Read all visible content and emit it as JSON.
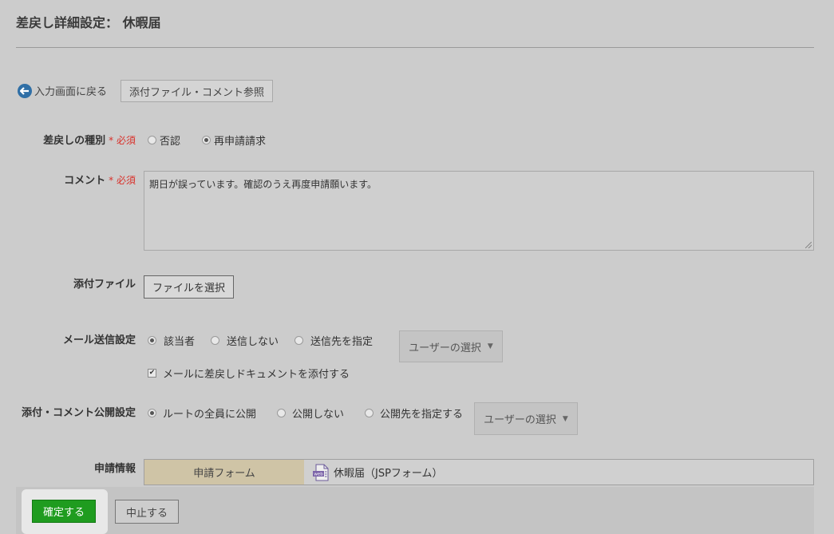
{
  "header": {
    "title": "差戻し詳細設定： 休暇届"
  },
  "toolbar": {
    "back_label": "入力画面に戻る",
    "attachments_button": "添付ファイル・コメント参照"
  },
  "form": {
    "required_marker": "* 必須",
    "reject_type": {
      "label": "差戻しの種別",
      "options": [
        {
          "label": "否認",
          "selected": false
        },
        {
          "label": "再申請請求",
          "selected": true
        }
      ]
    },
    "comment": {
      "label": "コメント",
      "value": "期日が誤っています。確認のうえ再度申請願います。"
    },
    "attachment": {
      "label": "添付ファイル",
      "button": "ファイルを選択"
    },
    "mail": {
      "label": "メール送信設定",
      "options": [
        {
          "label": "該当者",
          "selected": true
        },
        {
          "label": "送信しない",
          "selected": false
        },
        {
          "label": "送信先を指定",
          "selected": false
        }
      ],
      "user_select": "ユーザーの選択",
      "attach_checkbox": {
        "label": "メールに差戻しドキュメントを添付する",
        "checked": true
      }
    },
    "visibility": {
      "label": "添付・コメント公開設定",
      "options": [
        {
          "label": "ルートの全員に公開",
          "selected": true
        },
        {
          "label": "公開しない",
          "selected": false
        },
        {
          "label": "公開先を指定する",
          "selected": false
        }
      ],
      "user_select": "ユーザーの選択"
    },
    "application_info": {
      "label": "申請情報",
      "cell_label": "申請フォーム",
      "cell_value": "休暇届（JSPフォーム）",
      "icon_text": "web"
    }
  },
  "footer": {
    "confirm": "確定する",
    "cancel": "中止する"
  },
  "colors": {
    "accent_green": "#1f9c1f",
    "required_red": "#d9302a",
    "form_label_bg": "#cfc4a6",
    "back_icon_blue": "#2f6fa6"
  }
}
